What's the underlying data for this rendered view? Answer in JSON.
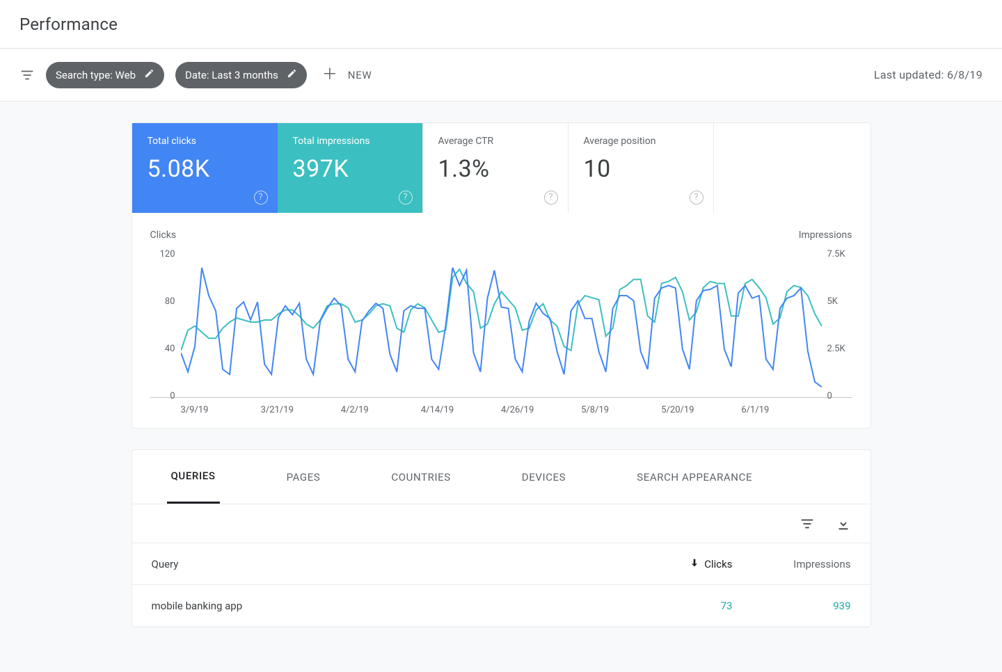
{
  "page": {
    "title": "Performance"
  },
  "filters": {
    "search_type_chip": "Search type: Web",
    "date_chip": "Date: Last 3 months",
    "new_label": "NEW",
    "last_updated": "Last updated: 6/8/19"
  },
  "metrics": {
    "clicks": {
      "label": "Total clicks",
      "value": "5.08K"
    },
    "impressions": {
      "label": "Total impressions",
      "value": "397K"
    },
    "ctr": {
      "label": "Average CTR",
      "value": "1.3%"
    },
    "position": {
      "label": "Average position",
      "value": "10"
    }
  },
  "chart_data": {
    "type": "line",
    "title": "",
    "x_dates": [
      "3/9/19",
      "3/21/19",
      "4/2/19",
      "4/14/19",
      "4/26/19",
      "5/8/19",
      "5/20/19",
      "6/1/19"
    ],
    "left_axis": {
      "label": "Clicks",
      "ticks": [
        120,
        80,
        40,
        0
      ],
      "min": 0,
      "max": 120
    },
    "right_axis": {
      "label": "Impressions",
      "ticks": [
        "7.5K",
        "5K",
        "2.5K",
        "0"
      ],
      "min": 0,
      "max": 7500
    },
    "series": [
      {
        "name": "Clicks",
        "axis": "left",
        "color": "#4285f4",
        "values": [
          35,
          20,
          40,
          102,
          80,
          68,
          22,
          18,
          70,
          75,
          61,
          75,
          26,
          18,
          63,
          72,
          65,
          74,
          30,
          18,
          60,
          70,
          78,
          72,
          30,
          20,
          60,
          68,
          74,
          70,
          34,
          20,
          68,
          72,
          70,
          70,
          30,
          22,
          56,
          102,
          88,
          100,
          35,
          20,
          78,
          100,
          71,
          70,
          30,
          20,
          60,
          74,
          66,
          62,
          36,
          18,
          68,
          76,
          62,
          62,
          36,
          20,
          70,
          80,
          80,
          76,
          36,
          22,
          78,
          86,
          88,
          86,
          38,
          22,
          76,
          84,
          85,
          88,
          38,
          24,
          82,
          88,
          78,
          80,
          30,
          22,
          70,
          78,
          80,
          86,
          36,
          12,
          8
        ]
      },
      {
        "name": "Impressions",
        "axis": "right",
        "color": "#3cbfc0",
        "values": [
          2300,
          3300,
          3500,
          3200,
          2900,
          2900,
          3400,
          3700,
          3900,
          3800,
          3700,
          3700,
          3800,
          3800,
          4100,
          4300,
          4300,
          4000,
          3600,
          3400,
          3800,
          4500,
          4600,
          4600,
          4400,
          3700,
          3800,
          4100,
          4500,
          4600,
          4500,
          3400,
          3200,
          4300,
          4600,
          4400,
          3800,
          3200,
          3300,
          5900,
          6300,
          5600,
          5200,
          3400,
          3600,
          4600,
          5200,
          4800,
          4400,
          3300,
          3400,
          4300,
          4600,
          3800,
          3500,
          2500,
          2300,
          4600,
          5000,
          4900,
          4800,
          3000,
          3400,
          5300,
          5500,
          5800,
          5800,
          4000,
          3700,
          5600,
          5700,
          5900,
          5200,
          3800,
          4200,
          5400,
          5700,
          5600,
          5600,
          4000,
          4000,
          5600,
          5800,
          5400,
          4900,
          3600,
          3900,
          5200,
          5500,
          5400,
          5000,
          4100,
          3500
        ]
      }
    ]
  },
  "table": {
    "tabs": [
      "QUERIES",
      "PAGES",
      "COUNTRIES",
      "DEVICES",
      "SEARCH APPEARANCE"
    ],
    "active_tab": 0,
    "columns": {
      "query": "Query",
      "clicks": "Clicks",
      "impressions": "Impressions"
    },
    "rows": [
      {
        "query": "mobile banking app",
        "clicks": "73",
        "impressions": "939"
      }
    ]
  }
}
